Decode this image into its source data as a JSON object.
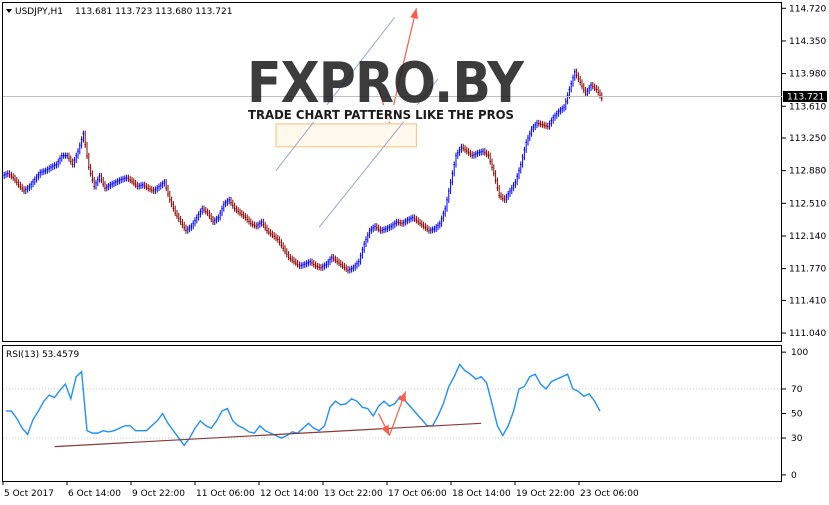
{
  "chart_data": [
    {
      "type": "candlestick",
      "symbol_label": "USDJPY,H1",
      "ohlc_label": "113.681 113.723 113.680 113.721",
      "current_price": 113.721,
      "current_price_label": "113.721",
      "ylim": [
        110.95,
        114.78
      ],
      "y_ticks": [
        "114.720",
        "114.350",
        "113.980",
        "113.610",
        "113.250",
        "112.880",
        "112.510",
        "112.140",
        "111.770",
        "111.410",
        "111.040"
      ],
      "x_ticks": [
        "5 Oct 2017",
        "6 Oct 14:00",
        "9 Oct 22:00",
        "11 Oct 06:00",
        "12 Oct 14:00",
        "13 Oct 22:00",
        "17 Oct 06:00",
        "18 Oct 14:00",
        "19 Oct 22:00",
        "23 Oct 06:00"
      ],
      "close_series": [
        112.85,
        112.8,
        112.72,
        112.65,
        112.7,
        112.78,
        112.86,
        112.88,
        112.92,
        112.95,
        113.05,
        113.05,
        112.95,
        113.1,
        113.3,
        112.92,
        112.7,
        112.82,
        112.68,
        112.72,
        112.75,
        112.78,
        112.8,
        112.76,
        112.7,
        112.72,
        112.68,
        112.65,
        112.7,
        112.75,
        112.55,
        112.4,
        112.3,
        112.2,
        112.25,
        112.35,
        112.45,
        112.4,
        112.3,
        112.35,
        112.5,
        112.55,
        112.45,
        112.4,
        112.35,
        112.28,
        112.25,
        112.3,
        112.2,
        112.15,
        112.1,
        112.0,
        111.9,
        111.85,
        111.8,
        111.82,
        111.85,
        111.8,
        111.78,
        111.82,
        111.9,
        111.85,
        111.8,
        111.75,
        111.78,
        111.85,
        112.05,
        112.2,
        112.25,
        112.2,
        112.22,
        112.25,
        112.3,
        112.28,
        112.32,
        112.35,
        112.3,
        112.25,
        112.2,
        112.22,
        112.28,
        112.45,
        112.75,
        113.05,
        113.15,
        113.1,
        113.05,
        113.08,
        113.1,
        113.05,
        112.85,
        112.6,
        112.55,
        112.65,
        112.75,
        112.95,
        113.2,
        113.35,
        113.42,
        113.4,
        113.38,
        113.48,
        113.55,
        113.6,
        113.8,
        114.0,
        113.88,
        113.75,
        113.85,
        113.8,
        113.7
      ],
      "channel_lines": [
        {
          "name": "channel-upper",
          "from": [
            50,
            112.88
          ],
          "to": [
            72,
            114.62
          ]
        },
        {
          "name": "channel-lower",
          "from": [
            58,
            112.24
          ],
          "to": [
            80,
            113.92
          ]
        }
      ],
      "zone": {
        "from_index": 50,
        "to_index": 76,
        "y_top": 113.41,
        "y_bottom": 113.15
      },
      "arrows": [
        {
          "name": "forecast-down-arrow",
          "from": [
            69,
            113.8
          ],
          "to": [
            71,
            113.42
          ]
        },
        {
          "name": "forecast-up-arrow",
          "from": [
            71,
            113.42
          ],
          "to": [
            76,
            114.72
          ]
        }
      ]
    },
    {
      "type": "line",
      "indicator_label": "RSI(13) 53.4579",
      "ylim": [
        -5,
        105
      ],
      "y_ticks": [
        "100",
        "70",
        "50",
        "30",
        "0"
      ],
      "values": [
        52,
        52,
        46,
        38,
        33,
        45,
        52,
        60,
        65,
        63,
        69,
        74,
        62,
        80,
        84,
        36,
        34,
        34,
        36,
        35,
        36,
        38,
        40,
        40,
        36,
        36,
        36,
        40,
        44,
        50,
        42,
        36,
        30,
        24,
        30,
        38,
        44,
        40,
        38,
        44,
        52,
        54,
        44,
        40,
        38,
        35,
        34,
        40,
        36,
        34,
        32,
        30,
        32,
        35,
        34,
        38,
        42,
        38,
        36,
        40,
        55,
        60,
        57,
        58,
        62,
        60,
        55,
        54,
        48,
        56,
        60,
        56,
        58,
        64,
        60,
        55,
        50,
        45,
        40,
        40,
        48,
        58,
        72,
        80,
        90,
        85,
        82,
        78,
        80,
        75,
        58,
        40,
        32,
        40,
        52,
        70,
        72,
        80,
        82,
        74,
        70,
        76,
        78,
        80,
        82,
        70,
        68,
        64,
        66,
        60,
        52
      ],
      "trendline": {
        "from": [
          9,
          23
        ],
        "to": [
          88,
          42
        ]
      },
      "arrows": [
        {
          "name": "rsi-down-arrow",
          "from": [
            69,
            50
          ],
          "to": [
            71,
            32
          ]
        },
        {
          "name": "rsi-up-arrow",
          "from": [
            71,
            32
          ],
          "to": [
            74,
            68
          ]
        }
      ]
    }
  ],
  "watermark": {
    "brand": "FXPRO.BY",
    "tagline": "TRADE CHART PATTERNS LIKE THE PROS"
  },
  "colors": {
    "bull": "#0000ff",
    "bear": "#8b0000",
    "rsi_line": "#1e90ff",
    "trend": "#8b3a3a",
    "arrow": "#ff5a4a",
    "channel": "#9aa8c8",
    "zone_border": "#f5c27a"
  }
}
